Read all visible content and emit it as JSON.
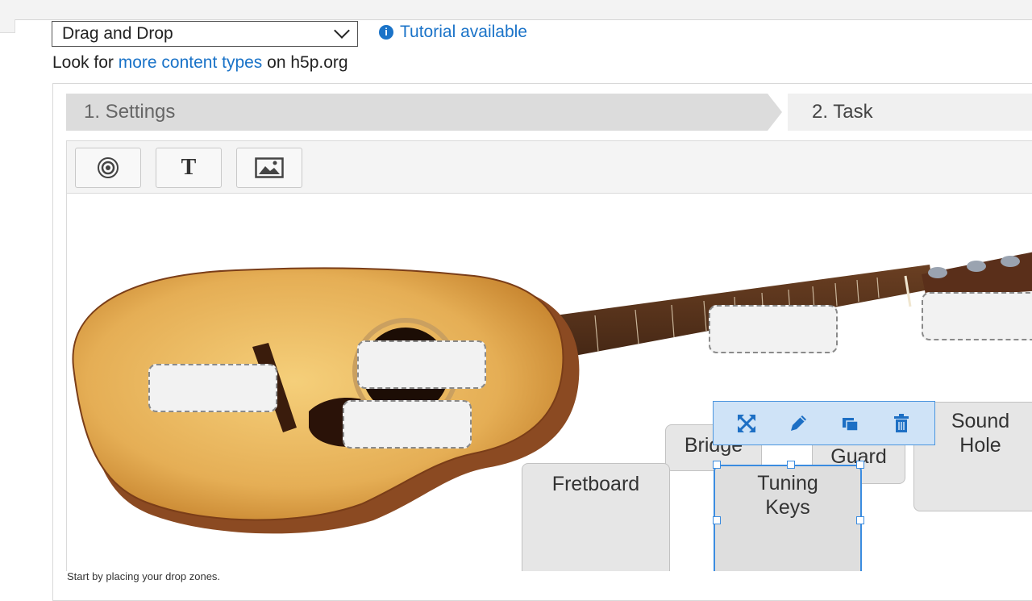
{
  "content_type_select": {
    "value": "Drag and Drop"
  },
  "tutorial": {
    "label": "Tutorial available"
  },
  "lookfor": {
    "prefix": "Look for ",
    "link": "more content types",
    "suffix": " on h5p.org"
  },
  "steps": [
    {
      "label": "1. Settings"
    },
    {
      "label": "2. Task"
    }
  ],
  "toolbar": {
    "dropzone_icon": "target-icon",
    "text_icon": "text-icon",
    "image_icon": "image-icon",
    "text_glyph": "T"
  },
  "elements": {
    "bridge": "Bridge",
    "guard": "Guard",
    "sound_hole": "Sound Hole",
    "fretboard": "Fretboard",
    "tuning_keys": "Tuning Keys"
  },
  "context_bar": {
    "icons": [
      "move-icon",
      "edit-icon",
      "layer-icon",
      "delete-icon"
    ]
  },
  "footer": {
    "note": "Start by placing your drop zones."
  },
  "colors": {
    "accent": "#1a73c8",
    "selection": "#3b8ce0",
    "guitar_body": "#e8b45a"
  }
}
